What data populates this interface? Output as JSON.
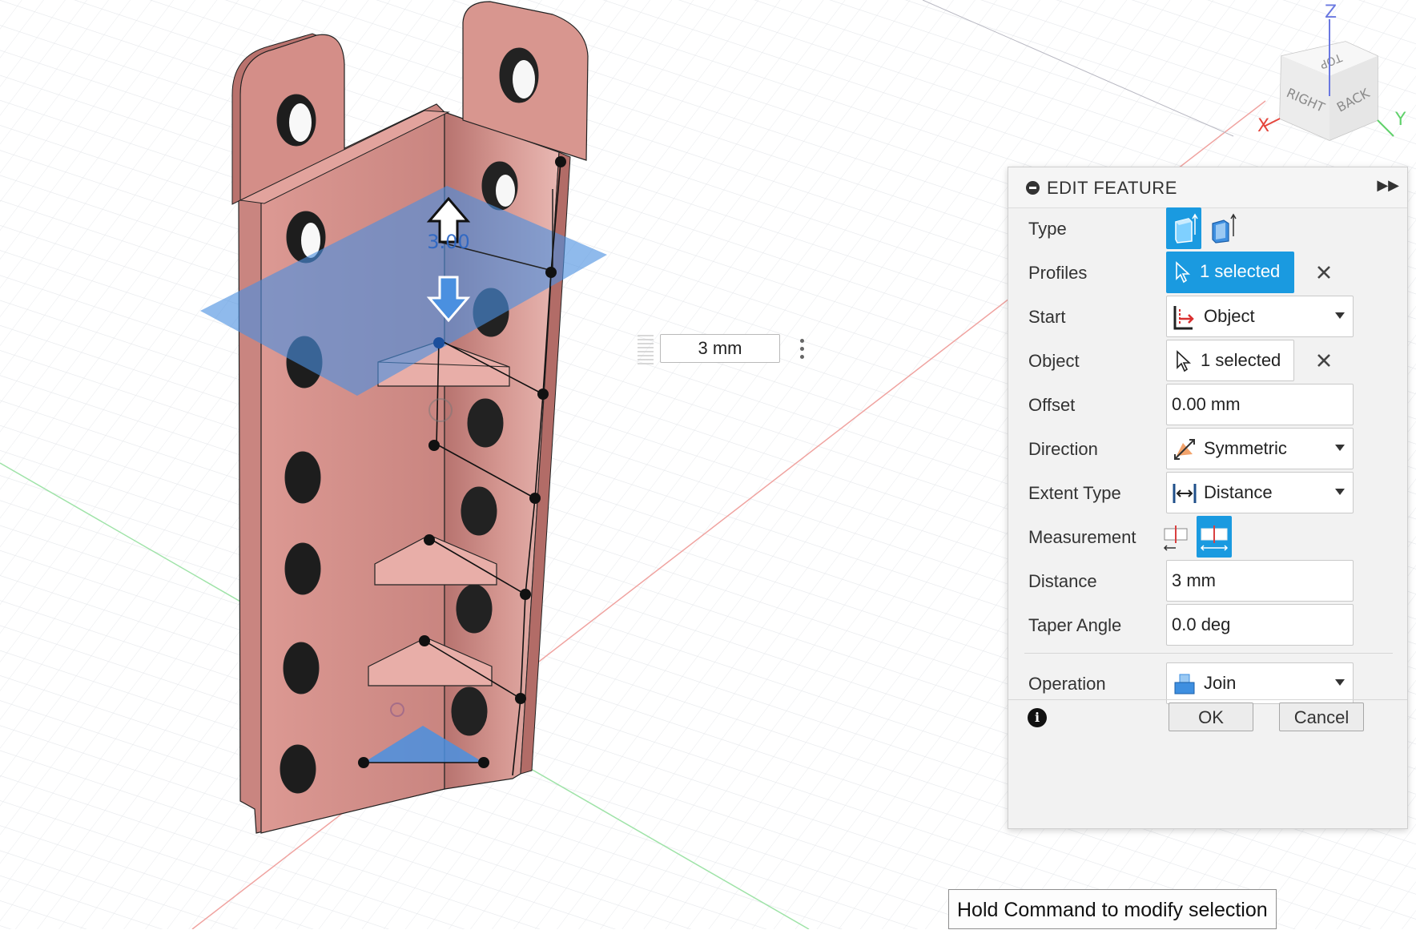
{
  "viewcube": {
    "faces": {
      "top": "TOP",
      "right": "RIGHT",
      "back": "BACK"
    },
    "axes": {
      "x": "X",
      "y": "Y",
      "z": "Z"
    },
    "colors": {
      "x": "#e5463c",
      "y": "#5fd16a",
      "z": "#6a78e0"
    }
  },
  "manipulator": {
    "dimension_label": "3.00",
    "value_input": "3 mm",
    "icons": {
      "up": "arrow-up-icon",
      "down": "arrow-down-icon",
      "more": "more-vertical-icon"
    }
  },
  "panel": {
    "title": "EDIT FEATURE",
    "icons": {
      "collapse": "collapse-icon",
      "expand": "double-chevron-right-icon",
      "info": "info-icon"
    },
    "accent": "#1a9ae0",
    "rows": {
      "type": {
        "label": "Type",
        "options": [
          "extrude-icon",
          "thin-extrude-icon"
        ],
        "selected": 0
      },
      "profiles": {
        "label": "Profiles",
        "value": "1 selected"
      },
      "start": {
        "label": "Start",
        "value": "Object"
      },
      "object": {
        "label": "Object",
        "value": "1 selected"
      },
      "offset": {
        "label": "Offset",
        "value": "0.00 mm"
      },
      "direction": {
        "label": "Direction",
        "value": "Symmetric"
      },
      "extent_type": {
        "label": "Extent Type",
        "value": "Distance"
      },
      "measurement": {
        "label": "Measurement",
        "options": [
          "half-length-icon",
          "whole-length-icon"
        ],
        "selected": 1
      },
      "distance": {
        "label": "Distance",
        "value": "3 mm"
      },
      "taper_angle": {
        "label": "Taper Angle",
        "value": "0.0 deg"
      },
      "operation": {
        "label": "Operation",
        "value": "Join"
      }
    },
    "buttons": {
      "ok": "OK",
      "cancel": "Cancel"
    }
  },
  "tooltip": "Hold Command to modify selection",
  "colors": {
    "part": "#d9938d",
    "selection": "#4a90e0",
    "panel_bg": "#f2f2f2"
  }
}
